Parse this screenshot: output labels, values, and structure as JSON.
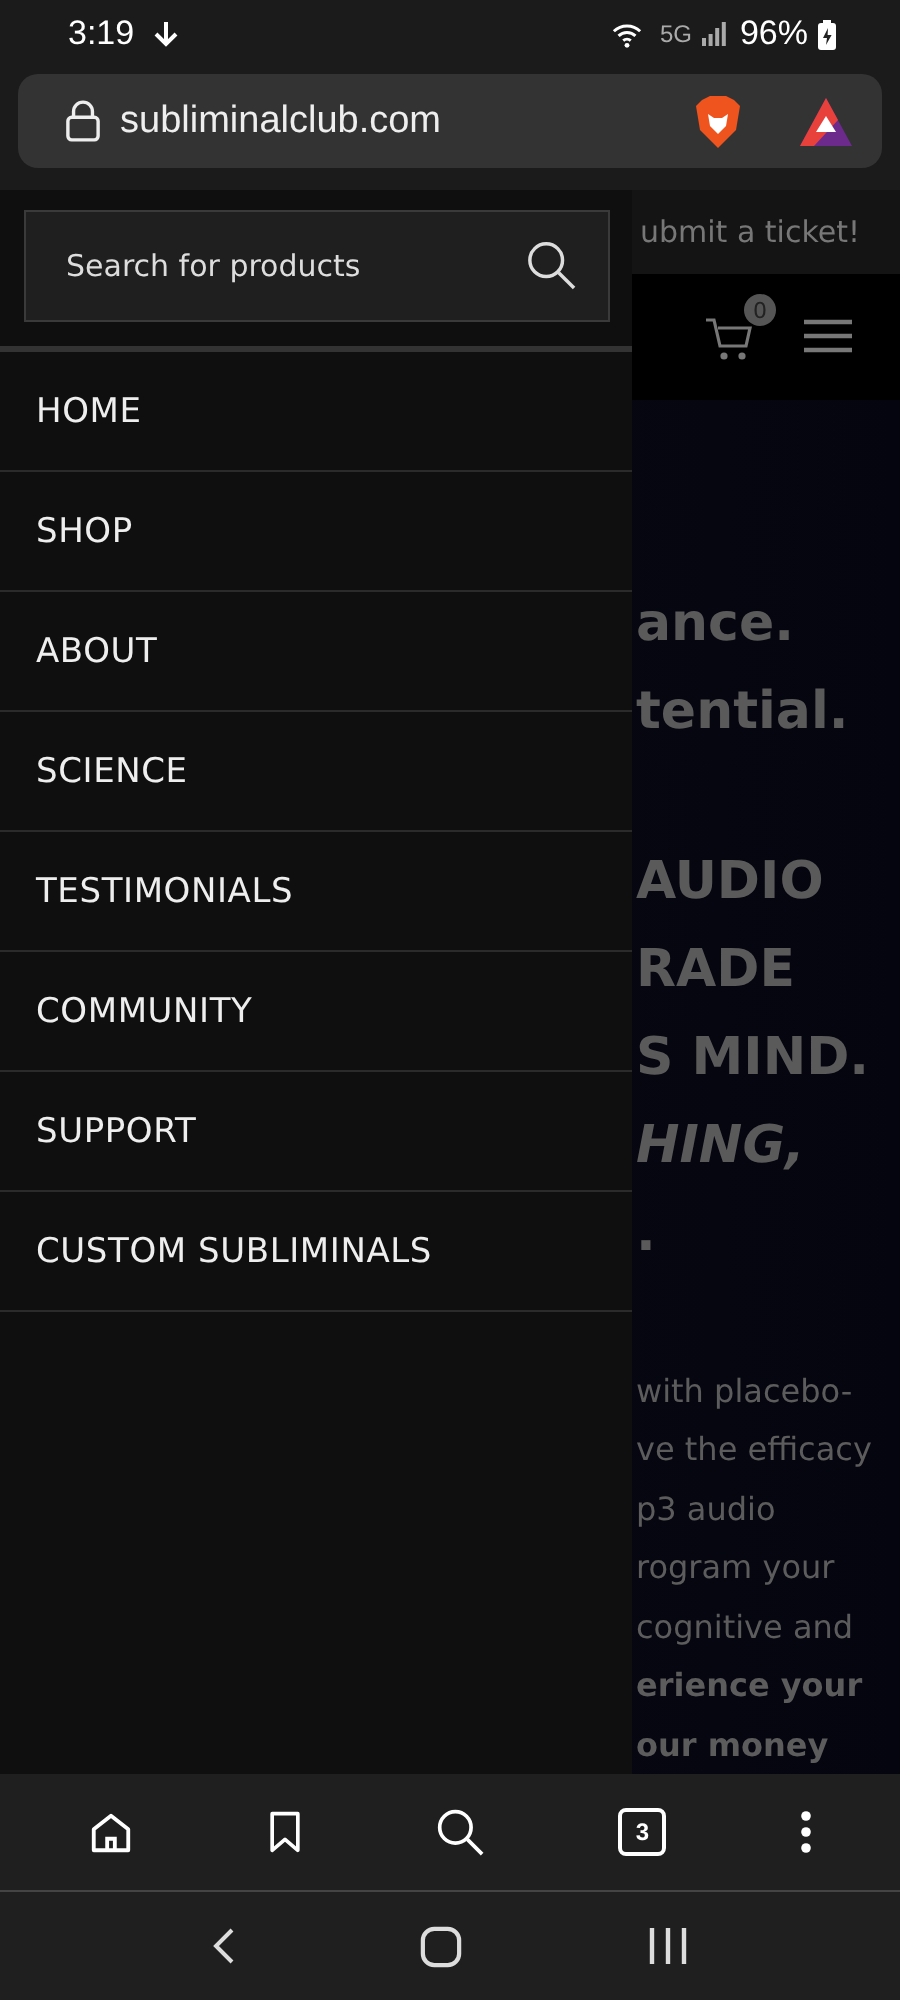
{
  "status_bar": {
    "time": "3:19",
    "network": "5G",
    "battery": "96%"
  },
  "browser": {
    "url": "subliminalclub.com",
    "tab_count": "3"
  },
  "page": {
    "notice": "ubmit a ticket!",
    "cart_count": "0",
    "heading_lines": [
      {
        "text": "ance.",
        "italic": false
      },
      {
        "text": "tential.",
        "italic": false
      },
      {
        "text": "AUDIO",
        "italic": false
      },
      {
        "text": "RADE",
        "italic": false
      },
      {
        "text": "S MIND.",
        "italic": false
      },
      {
        "text": "HING,",
        "italic": true
      },
      {
        "text": ".",
        "italic": false
      }
    ],
    "body_lines": [
      {
        "text": "with placebo-",
        "bold": false
      },
      {
        "text": "ve the efficacy",
        "bold": false
      },
      {
        "text": "p3 audio",
        "bold": false
      },
      {
        "text": "rogram your",
        "bold": false
      },
      {
        "text": "cognitive and",
        "bold": false
      },
      {
        "text": "erience your",
        "bold": true
      },
      {
        "text": "our money",
        "bold": true
      }
    ]
  },
  "drawer": {
    "search": {
      "placeholder": "Search for products"
    },
    "menu": [
      {
        "label": "HOME"
      },
      {
        "label": "SHOP"
      },
      {
        "label": "ABOUT"
      },
      {
        "label": "SCIENCE"
      },
      {
        "label": "TESTIMONIALS"
      },
      {
        "label": "COMMUNITY"
      },
      {
        "label": "SUPPORT"
      },
      {
        "label": "CUSTOM SUBLIMINALS"
      }
    ]
  }
}
